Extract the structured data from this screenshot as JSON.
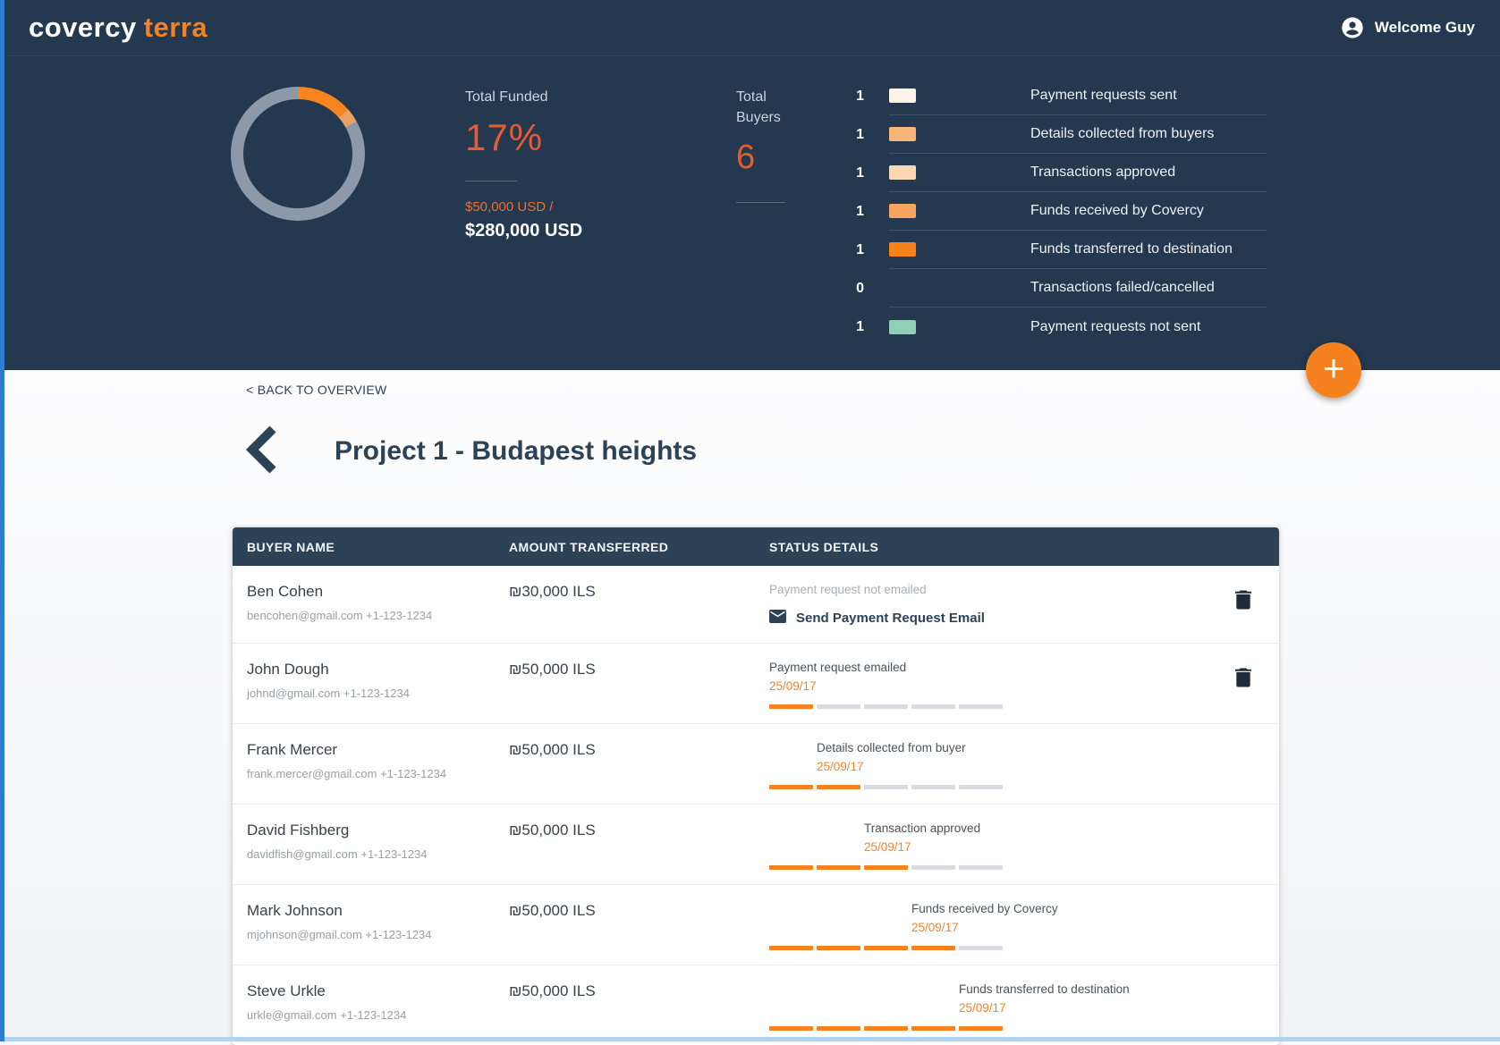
{
  "brand": {
    "name_primary": "covercy",
    "name_secondary": "terra"
  },
  "header": {
    "welcome_text": "Welcome Guy"
  },
  "colors": {
    "accent_orange": "#f5821f",
    "number_orange": "#e65c30",
    "header_navy": "#24384f",
    "table_header_navy": "#2b4257",
    "progress_gray": "#d8dce0",
    "legend_teal": "#90d0b6"
  },
  "hero": {
    "total_funded_label": "Total Funded",
    "total_funded_pct": "17%",
    "funded_amount": "$50,000 USD /",
    "total_amount": "$280,000 USD",
    "total_buyers_label": "Total Buyers",
    "total_buyers_count": "6",
    "donut": {
      "pct_label": 17,
      "segments": [
        {
          "color": "#f6851f",
          "from": 0,
          "to": 13.5
        },
        {
          "color": "#e9a263",
          "from": 13.5,
          "to": 17
        }
      ],
      "rest_color": "#8d99a8"
    },
    "legend": [
      {
        "count": "1",
        "color": "#fdf3e8",
        "label": "Payment requests sent"
      },
      {
        "count": "1",
        "color": "#f9b478",
        "label": "Details collected from buyers"
      },
      {
        "count": "1",
        "color": "#fbd7b4",
        "label": "Transactions approved"
      },
      {
        "count": "1",
        "color": "#f9a55f",
        "label": "Funds received by Covercy"
      },
      {
        "count": "1",
        "color": "#f6821e",
        "label": "Funds transferred to destination"
      },
      {
        "count": "0",
        "color": null,
        "label": "Transactions failed/cancelled"
      },
      {
        "count": "1",
        "color": "#90d0b6",
        "label": "Payment requests not sent"
      }
    ]
  },
  "content": {
    "back_chevron": "<",
    "back_link_label": "BACK TO OVERVIEW",
    "page_title": "Project 1 - Budapest heights",
    "fab_plus": "+",
    "table": {
      "columns": {
        "buyer": "BUYER NAME",
        "amount": "AMOUNT TRANSFERRED",
        "status": "STATUS DETAILS"
      },
      "progress_total": 5,
      "rows": [
        {
          "name": "Ben Cohen",
          "contact": "bencohen@gmail.com +1-123-1234",
          "amount": "₪30,000 ILS",
          "status": "Payment request not emailed",
          "date": "",
          "progress": null,
          "action": "Send Payment Request Email",
          "deletable": true
        },
        {
          "name": "John Dough",
          "contact": "johnd@gmail.com +1-123-1234",
          "amount": "₪50,000 ILS",
          "status": "Payment request emailed",
          "date": "25/09/17",
          "progress": 1,
          "deletable": true
        },
        {
          "name": "Frank Mercer",
          "contact": "frank.mercer@gmail.com +1-123-1234",
          "amount": "₪50,000 ILS",
          "status": "Details collected from buyer",
          "date": "25/09/17",
          "progress": 2
        },
        {
          "name": "David Fishberg",
          "contact": "davidfish@gmail.com +1-123-1234",
          "amount": "₪50,000 ILS",
          "status": "Transaction approved",
          "date": "25/09/17",
          "progress": 3
        },
        {
          "name": "Mark Johnson",
          "contact": "mjohnson@gmail.com +1-123-1234",
          "amount": "₪50,000 ILS",
          "status": "Funds received by Covercy",
          "date": "25/09/17",
          "progress": 4
        },
        {
          "name": "Steve Urkle",
          "contact": "urkle@gmail.com +1-123-1234",
          "amount": "₪50,000 ILS",
          "status": "Funds transferred to destination",
          "date": "25/09/17",
          "progress": 5
        }
      ]
    }
  }
}
